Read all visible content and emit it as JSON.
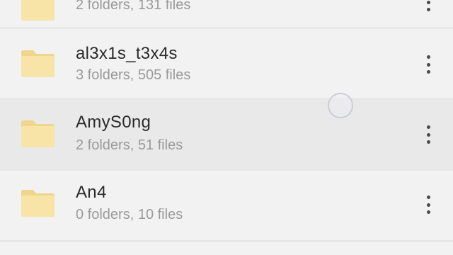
{
  "folders": [
    {
      "name": "",
      "meta": "2 folders, 131 files"
    },
    {
      "name": "al3x1s_t3x4s",
      "meta": "3 folders, 505 files"
    },
    {
      "name": "AmyS0ng",
      "meta": "2 folders, 51 files"
    },
    {
      "name": "An4",
      "meta": "0 folders, 10 files"
    }
  ],
  "icons": {
    "folder": "folder-icon",
    "more": "more-vertical-icon",
    "touch": "touch-indicator"
  },
  "colors": {
    "folder_fill": "#f7e4a6",
    "folder_tab": "#efd68c",
    "row_bg": "#f2f2f2",
    "pressed_bg": "#e9e9e9",
    "divider": "#e4e4e4"
  }
}
